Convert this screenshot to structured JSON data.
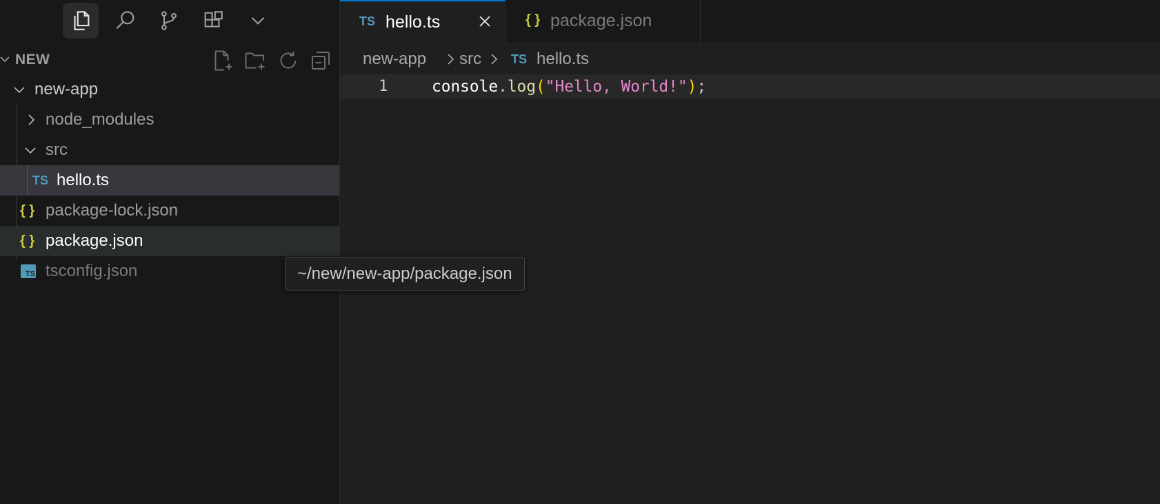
{
  "colors": {
    "background": "#181818",
    "editor_background": "#1f1f1f",
    "selected_row": "#37373d",
    "hover_row": "#2a2d2e",
    "ts_icon": "#519aba",
    "json_icon": "#cbcb41",
    "string": "#ce9178",
    "function": "#dcdcaa"
  },
  "activity_bar": {
    "items": [
      {
        "icon": "files-icon",
        "active": true
      },
      {
        "icon": "search-icon"
      },
      {
        "icon": "source-control-icon"
      },
      {
        "icon": "extensions-icon"
      },
      {
        "icon": "chevron-down-icon"
      }
    ]
  },
  "explorer": {
    "section_title": "NEW",
    "actions": [
      "new-file-icon",
      "new-folder-icon",
      "refresh-icon",
      "collapse-all-icon"
    ],
    "tree": [
      {
        "label": "new-app",
        "type": "folder",
        "expanded": true
      },
      {
        "label": "node_modules",
        "type": "folder",
        "expanded": false
      },
      {
        "label": "src",
        "type": "folder",
        "expanded": true
      },
      {
        "label": "hello.ts",
        "type": "ts",
        "icon_text": "TS",
        "selected": true
      },
      {
        "label": "package-lock.json",
        "type": "json",
        "icon_text": "{ }"
      },
      {
        "label": "package.json",
        "type": "json",
        "icon_text": "{ }",
        "hovered": true
      },
      {
        "label": "tsconfig.json",
        "type": "tsconfig",
        "icon_text": "TS"
      }
    ]
  },
  "tabs": [
    {
      "label": "hello.ts",
      "icon_text": "TS",
      "active": true
    },
    {
      "label": "package.json",
      "icon_text": "{ }",
      "active": false
    }
  ],
  "breadcrumb": {
    "items": [
      "new-app",
      "src",
      "hello.ts"
    ],
    "file_icon_text": "TS"
  },
  "editor": {
    "line_number": "1",
    "tokens": {
      "object": "console",
      "dot": ".",
      "method": "log",
      "open_paren": "(",
      "string": "\"Hello, World!\"",
      "close_paren": ")",
      "semicolon": ";"
    }
  },
  "tooltip": {
    "text": "~/new/new-app/package.json"
  }
}
